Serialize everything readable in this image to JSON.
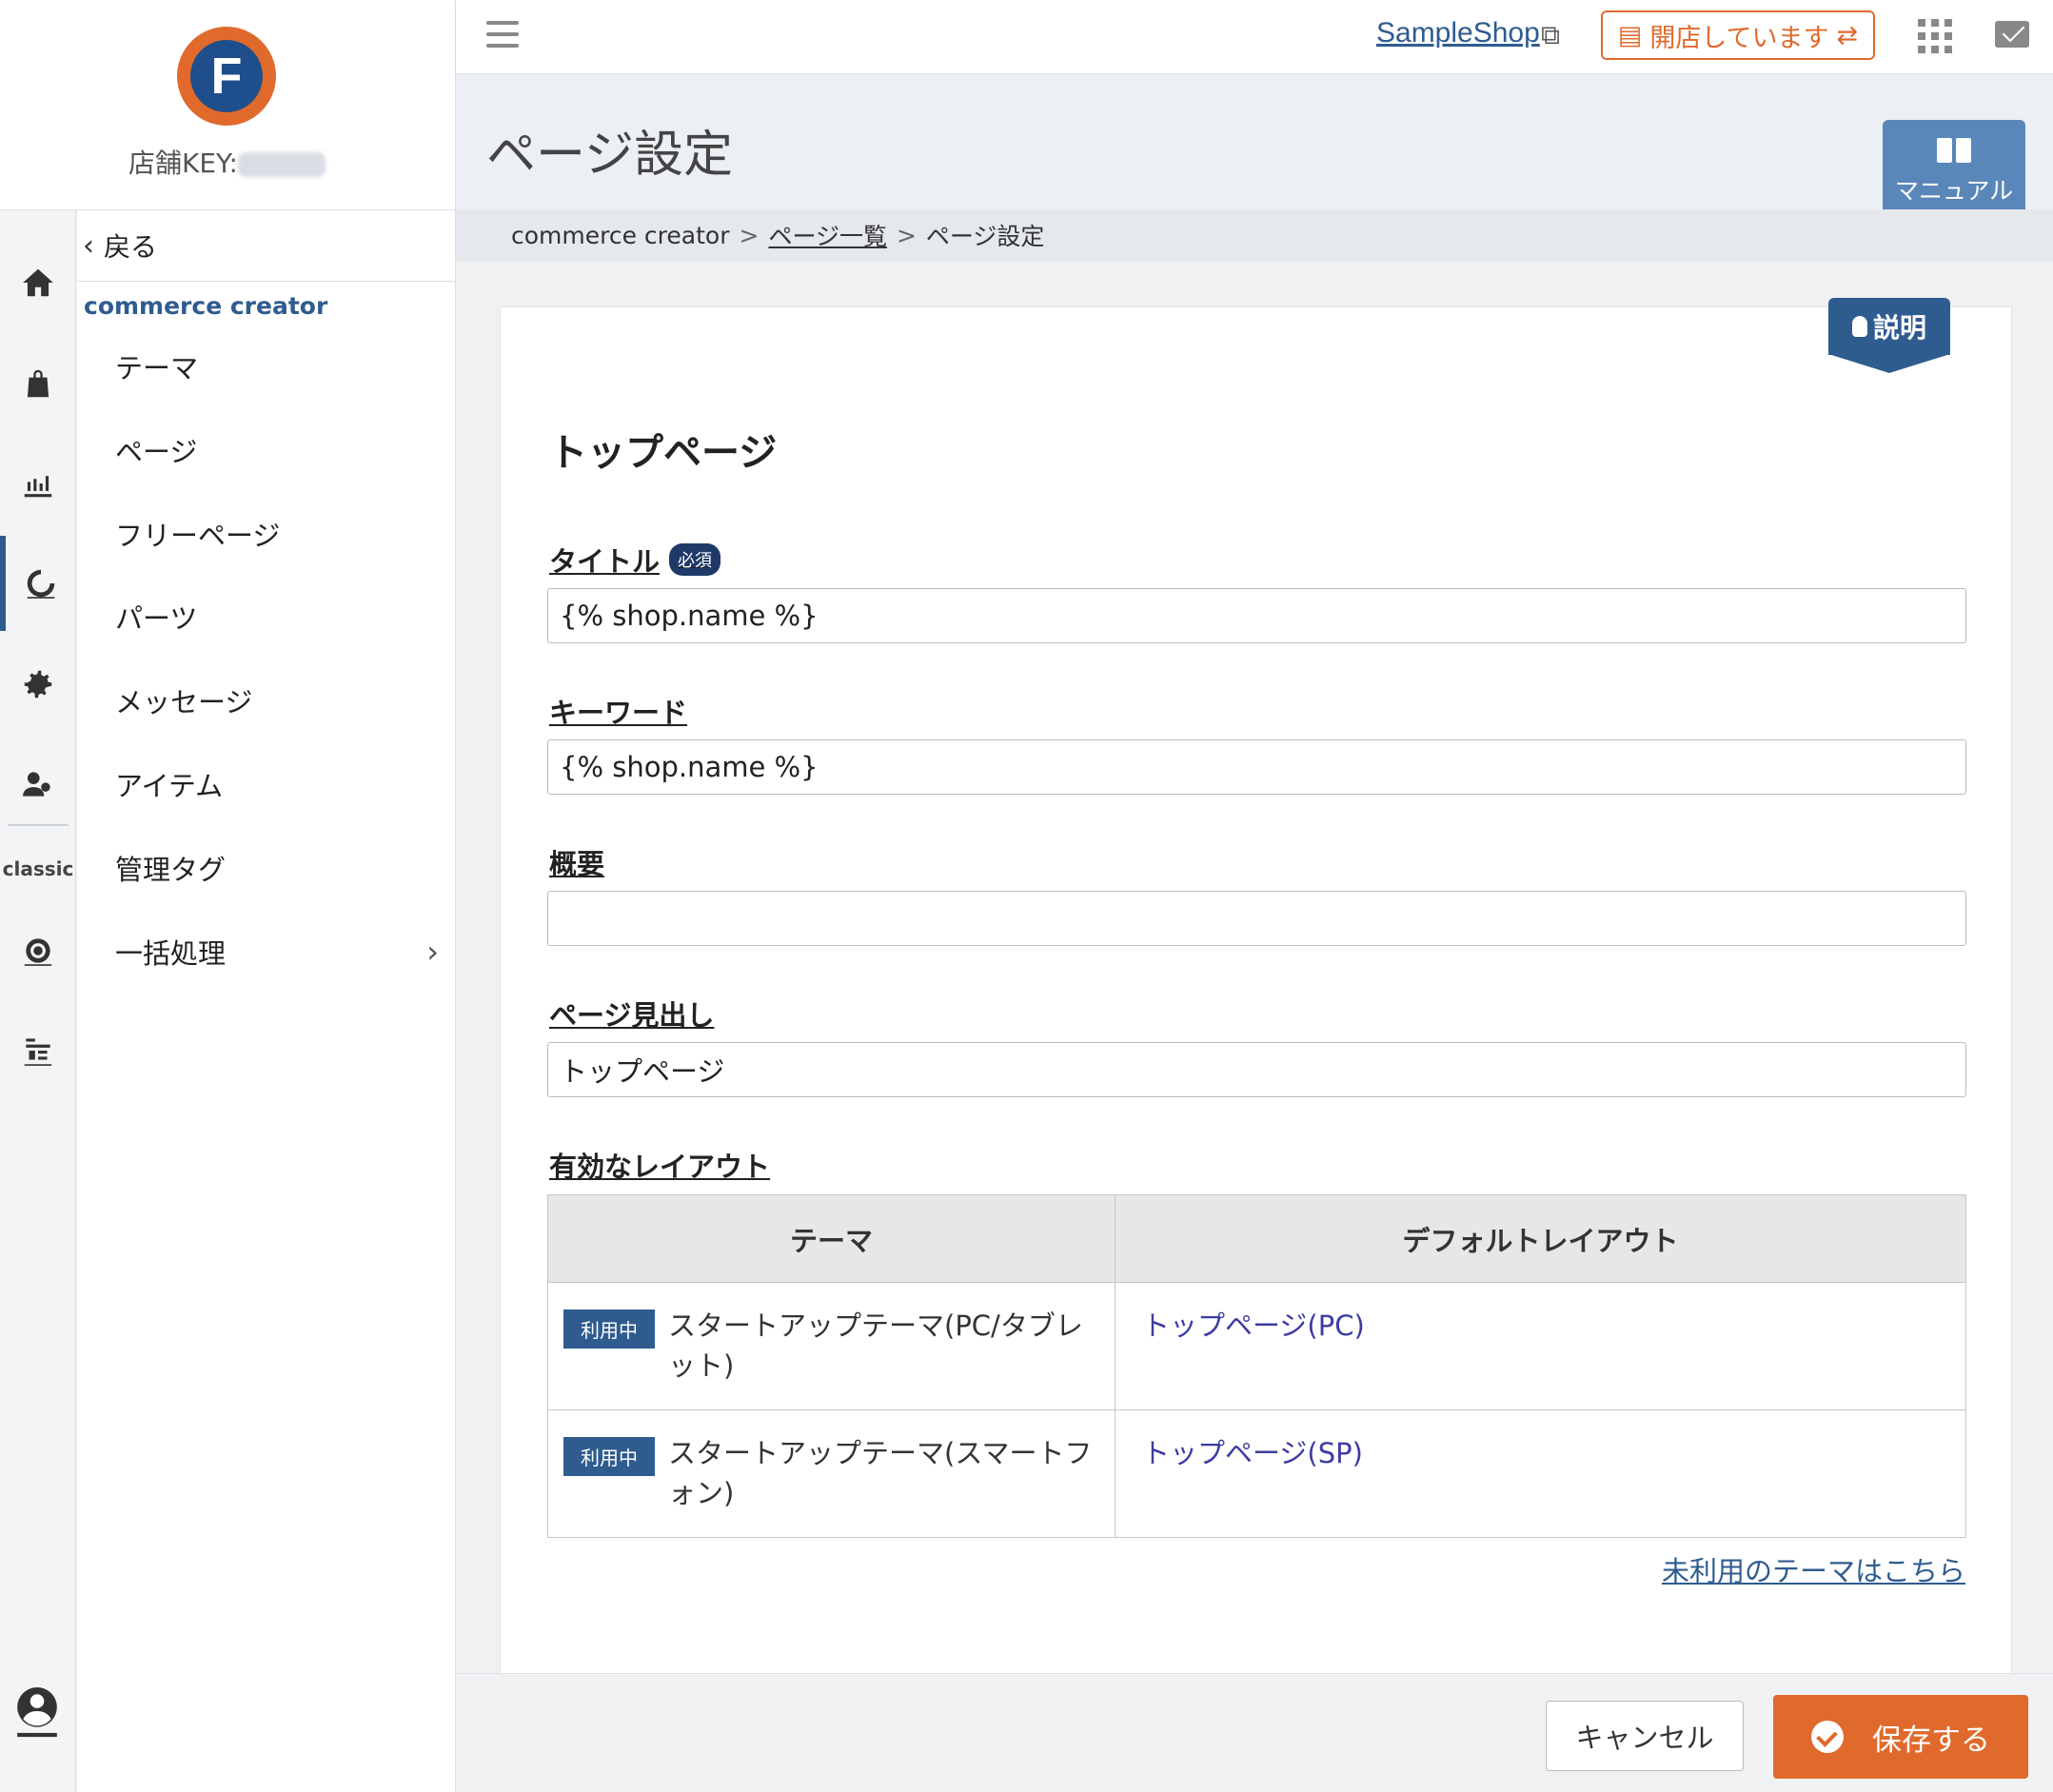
{
  "brand": {
    "logo_letter": "F",
    "store_key_label": "店舗KEY:"
  },
  "subnav": {
    "back_label": "戻る",
    "group_label": "commerce creator",
    "items": [
      {
        "label": "テーマ"
      },
      {
        "label": "ページ"
      },
      {
        "label": "フリーページ"
      },
      {
        "label": "パーツ"
      },
      {
        "label": "メッセージ"
      },
      {
        "label": "アイテム"
      },
      {
        "label": "管理タグ"
      },
      {
        "label": "一括処理"
      }
    ]
  },
  "rail": {
    "classic_label": "classic"
  },
  "topbar": {
    "shop_name": "SampleShop",
    "status_label": "開店しています",
    "status_color": "#e06a2c"
  },
  "header": {
    "page_title": "ページ設定",
    "manual_label": "マニュアル",
    "breadcrumbs": {
      "root": "commerce creator",
      "list": "ページ一覧",
      "current": "ページ設定",
      "separator": ">"
    }
  },
  "card": {
    "hint_label": "説明",
    "section_title": "トップページ",
    "fields": {
      "title": {
        "label": "タイトル",
        "required_badge": "必須",
        "value": "{% shop.name %}"
      },
      "keywords": {
        "label": "キーワード",
        "value": "{% shop.name %}"
      },
      "summary": {
        "label": "概要",
        "value": ""
      },
      "heading": {
        "label": "ページ見出し",
        "value": "トップページ"
      }
    },
    "layouts": {
      "label": "有効なレイアウト",
      "columns": [
        "テーマ",
        "デフォルトレイアウト"
      ],
      "rows": [
        {
          "badge": "利用中",
          "theme": "スタートアップテーマ(PC/タブレット)",
          "layout": "トップページ(PC)"
        },
        {
          "badge": "利用中",
          "theme": "スタートアップテーマ(スマートフォン)",
          "layout": "トップページ(SP)"
        }
      ]
    },
    "unused_link": "未利用のテーマはこちら"
  },
  "footer": {
    "cancel_label": "キャンセル",
    "save_label": "保存する"
  },
  "colors": {
    "primary": "#2f5c8f",
    "accent": "#e06a2c"
  }
}
